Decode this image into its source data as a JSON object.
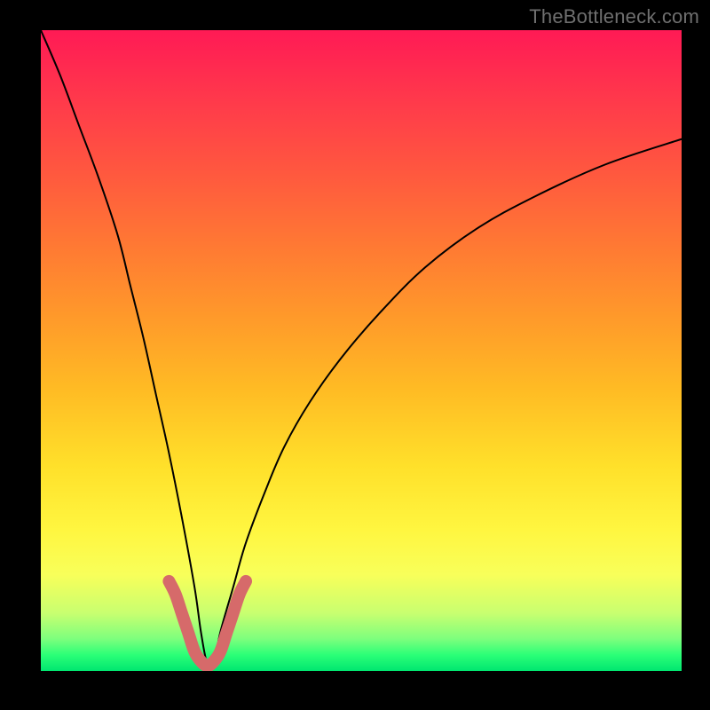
{
  "watermark": "TheBottleneck.com",
  "colors": {
    "frame": "#000000",
    "curve_stroke": "#000000",
    "highlight_stroke": "#d66a6a",
    "gradient_stops": [
      "#ff1a55",
      "#ff3c4a",
      "#ff5a3e",
      "#ff7a33",
      "#ff9a2a",
      "#ffbb24",
      "#ffe02a",
      "#fff640",
      "#f8ff5a",
      "#c8ff70",
      "#7dff7d",
      "#2bff77",
      "#00e670"
    ]
  },
  "chart_data": {
    "type": "line",
    "title": "",
    "xlabel": "",
    "ylabel": "",
    "xlim": [
      0,
      100
    ],
    "ylim": [
      0,
      100
    ],
    "note": "x and y in percent of plot width/height; y=0 is bottom (best/green), y=100 is top (worst/red). Curve dips to ~0 near x≈26 and rises on both sides.",
    "series": [
      {
        "name": "bottleneck-curve",
        "x": [
          0,
          3,
          6,
          9,
          12,
          14,
          16,
          18,
          20,
          22,
          24,
          25,
          26,
          27,
          28,
          30,
          32,
          35,
          38,
          42,
          47,
          53,
          60,
          68,
          77,
          88,
          100
        ],
        "y": [
          100,
          93,
          85,
          77,
          68,
          60,
          52,
          43,
          34,
          24,
          13,
          6,
          1,
          1,
          6,
          13,
          20,
          28,
          35,
          42,
          49,
          56,
          63,
          69,
          74,
          79,
          83
        ]
      },
      {
        "name": "highlight-segment",
        "x": [
          20,
          21,
          22,
          23,
          24,
          25,
          26,
          27,
          28,
          29,
          30,
          31,
          32
        ],
        "y": [
          14,
          12,
          9,
          6,
          3,
          1.5,
          0.8,
          1.5,
          3,
          6,
          9,
          12,
          14
        ]
      }
    ]
  }
}
